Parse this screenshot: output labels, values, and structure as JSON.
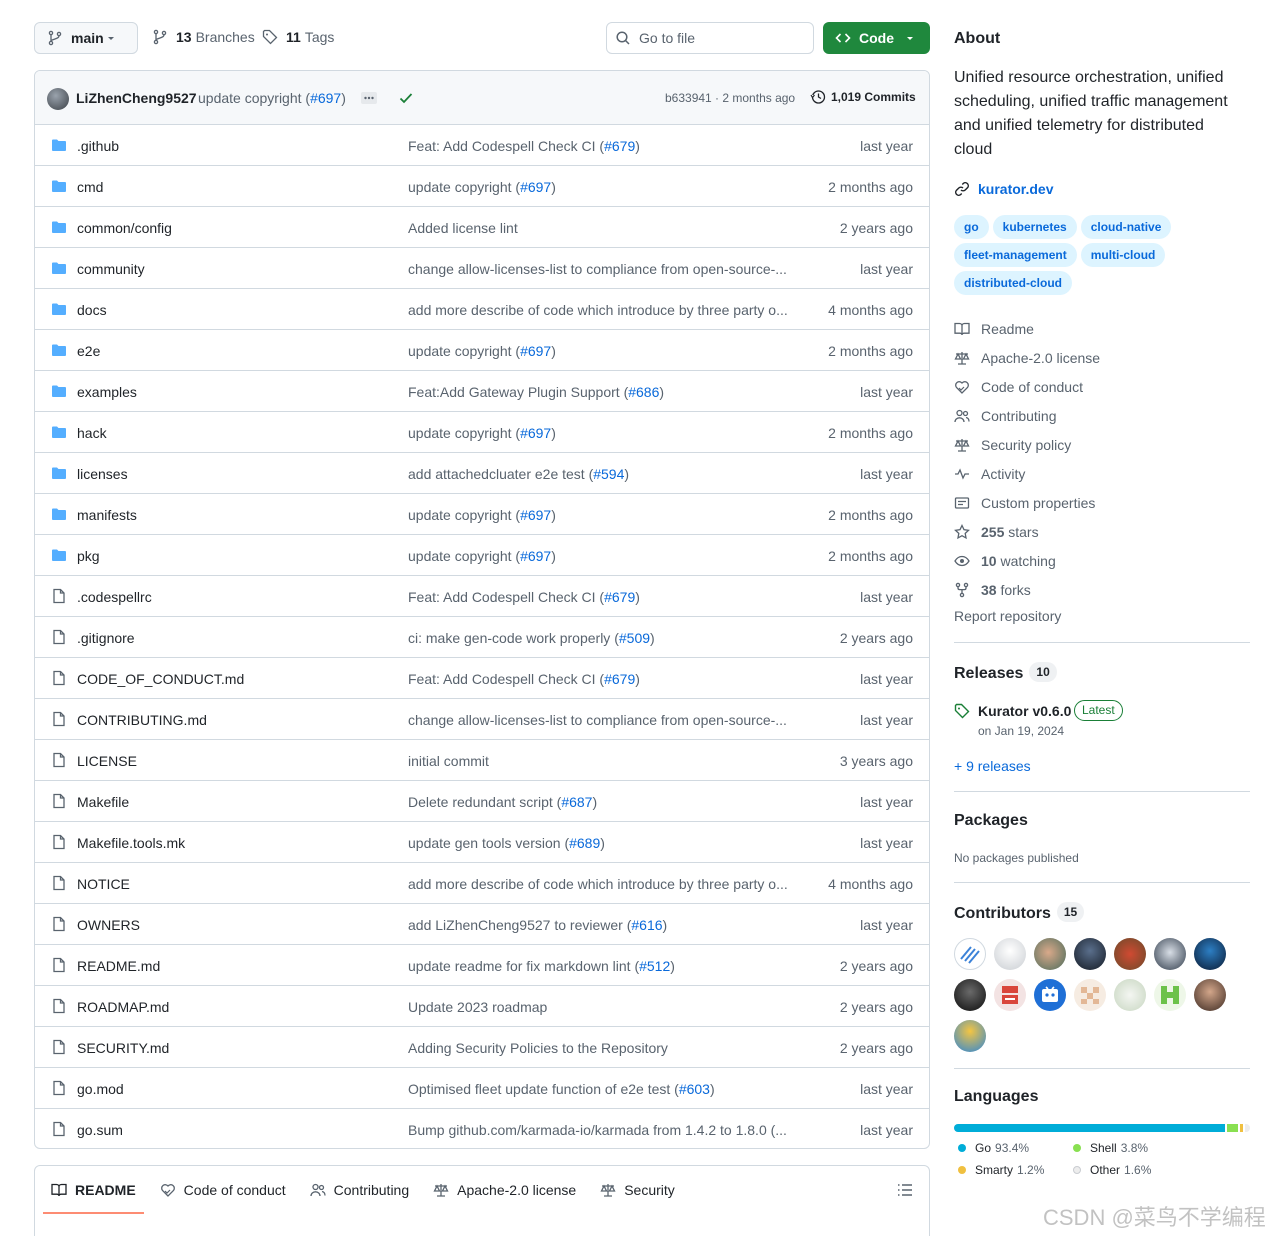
{
  "toolbar": {
    "branch": "main",
    "branches_count": "13",
    "branches_label": "Branches",
    "tags_count": "11",
    "tags_label": "Tags",
    "goto_placeholder": "Go to file",
    "code_label": "Code"
  },
  "commit": {
    "author": "LiZhenCheng9527",
    "message": "update copyright (",
    "pr": "#697",
    "message_end": ")",
    "hash_time": "b633941 · 2 months ago",
    "commits_count": "1,019 Commits"
  },
  "files": [
    {
      "name": ".github",
      "type": "dir",
      "msg": "Feat: Add Codespell Check CI (",
      "pr": "#679",
      "end": ")",
      "date": "last year"
    },
    {
      "name": "cmd",
      "type": "dir",
      "msg": "update copyright (",
      "pr": "#697",
      "end": ")",
      "date": "2 months ago"
    },
    {
      "name": "common/config",
      "type": "dir",
      "msg": "Added license lint",
      "pr": "",
      "end": "",
      "date": "2 years ago"
    },
    {
      "name": "community",
      "type": "dir",
      "msg": "change allow-licenses-list to compliance from open-source-...",
      "pr": "",
      "end": "",
      "date": "last year"
    },
    {
      "name": "docs",
      "type": "dir",
      "msg": "add more describe of code which introduce by three party o...",
      "pr": "",
      "end": "",
      "date": "4 months ago"
    },
    {
      "name": "e2e",
      "type": "dir",
      "msg": "update copyright (",
      "pr": "#697",
      "end": ")",
      "date": "2 months ago"
    },
    {
      "name": "examples",
      "type": "dir",
      "msg": "Feat:Add Gateway Plugin Support (",
      "pr": "#686",
      "end": ")",
      "date": "last year"
    },
    {
      "name": "hack",
      "type": "dir",
      "msg": "update copyright (",
      "pr": "#697",
      "end": ")",
      "date": "2 months ago"
    },
    {
      "name": "licenses",
      "type": "dir",
      "msg": "add attachedcluater e2e test (",
      "pr": "#594",
      "end": ")",
      "date": "last year"
    },
    {
      "name": "manifests",
      "type": "dir",
      "msg": "update copyright (",
      "pr": "#697",
      "end": ")",
      "date": "2 months ago"
    },
    {
      "name": "pkg",
      "type": "dir",
      "msg": "update copyright (",
      "pr": "#697",
      "end": ")",
      "date": "2 months ago"
    },
    {
      "name": ".codespellrc",
      "type": "file",
      "msg": "Feat: Add Codespell Check CI (",
      "pr": "#679",
      "end": ")",
      "date": "last year"
    },
    {
      "name": ".gitignore",
      "type": "file",
      "msg": "ci: make gen-code work properly (",
      "pr": "#509",
      "end": ")",
      "date": "2 years ago"
    },
    {
      "name": "CODE_OF_CONDUCT.md",
      "type": "file",
      "msg": "Feat: Add Codespell Check CI (",
      "pr": "#679",
      "end": ")",
      "date": "last year"
    },
    {
      "name": "CONTRIBUTING.md",
      "type": "file",
      "msg": "change allow-licenses-list to compliance from open-source-...",
      "pr": "",
      "end": "",
      "date": "last year"
    },
    {
      "name": "LICENSE",
      "type": "file",
      "msg": "initial commit",
      "pr": "",
      "end": "",
      "date": "3 years ago"
    },
    {
      "name": "Makefile",
      "type": "file",
      "msg": "Delete redundant script (",
      "pr": "#687",
      "end": ")",
      "date": "last year"
    },
    {
      "name": "Makefile.tools.mk",
      "type": "file",
      "msg": "update gen tools version (",
      "pr": "#689",
      "end": ")",
      "date": "last year"
    },
    {
      "name": "NOTICE",
      "type": "file",
      "msg": "add more describe of code which introduce by three party o...",
      "pr": "",
      "end": "",
      "date": "4 months ago"
    },
    {
      "name": "OWNERS",
      "type": "file",
      "msg": "add LiZhenCheng9527 to reviewer (",
      "pr": "#616",
      "end": ")",
      "date": "last year"
    },
    {
      "name": "README.md",
      "type": "file",
      "msg": "update readme for fix markdown lint (",
      "pr": "#512",
      "end": ")",
      "date": "2 years ago"
    },
    {
      "name": "ROADMAP.md",
      "type": "file",
      "msg": "Update 2023 roadmap",
      "pr": "",
      "end": "",
      "date": "2 years ago"
    },
    {
      "name": "SECURITY.md",
      "type": "file",
      "msg": "Adding Security Policies to the Repository",
      "pr": "",
      "end": "",
      "date": "2 years ago"
    },
    {
      "name": "go.mod",
      "type": "file",
      "msg": "Optimised fleet update function of e2e test (",
      "pr": "#603",
      "end": ")",
      "date": "last year"
    },
    {
      "name": "go.sum",
      "type": "file",
      "msg": "Bump github.com/karmada-io/karmada from 1.4.2 to 1.8.0 (...",
      "pr": "",
      "end": "",
      "date": "last year"
    }
  ],
  "readme_tabs": [
    "README",
    "Code of conduct",
    "Contributing",
    "Apache-2.0 license",
    "Security"
  ],
  "about": {
    "title": "About",
    "description": "Unified resource orchestration, unified scheduling, unified traffic management and unified telemetry for distributed cloud",
    "website": "kurator.dev",
    "topics": [
      "go",
      "kubernetes",
      "cloud-native",
      "fleet-management",
      "multi-cloud",
      "distributed-cloud"
    ],
    "links": [
      {
        "icon": "book-icon",
        "label": "Readme"
      },
      {
        "icon": "law-icon",
        "label": "Apache-2.0 license"
      },
      {
        "icon": "heart-hands-icon",
        "label": "Code of conduct"
      },
      {
        "icon": "people-icon",
        "label": "Contributing"
      },
      {
        "icon": "law-icon",
        "label": "Security policy"
      },
      {
        "icon": "pulse-icon",
        "label": "Activity"
      },
      {
        "icon": "note-icon",
        "label": "Custom properties"
      },
      {
        "icon": "star-icon",
        "count": "255",
        "label": "stars"
      },
      {
        "icon": "eye-icon",
        "count": "10",
        "label": "watching"
      },
      {
        "icon": "fork-icon",
        "count": "38",
        "label": "forks"
      }
    ],
    "report": "Report repository"
  },
  "releases": {
    "title": "Releases",
    "count": "10",
    "latest_name": "Kurator v0.6.0",
    "latest_badge": "Latest",
    "latest_date": "on Jan 19, 2024",
    "more": "+ 9 releases"
  },
  "packages": {
    "title": "Packages",
    "none": "No packages published"
  },
  "contributors": {
    "title": "Contributors",
    "count": "15"
  },
  "languages": {
    "title": "Languages",
    "items": [
      {
        "name": "Go",
        "pct": "93.4%",
        "value": 93.4,
        "color": "#00ADD8"
      },
      {
        "name": "Shell",
        "pct": "3.8%",
        "value": 3.8,
        "color": "#89e051"
      },
      {
        "name": "Smarty",
        "pct": "1.2%",
        "value": 1.2,
        "color": "#f0c040"
      },
      {
        "name": "Other",
        "pct": "1.6%",
        "value": 1.6,
        "color": "#ededed"
      }
    ]
  },
  "watermark": "CSDN @菜鸟不学编程"
}
